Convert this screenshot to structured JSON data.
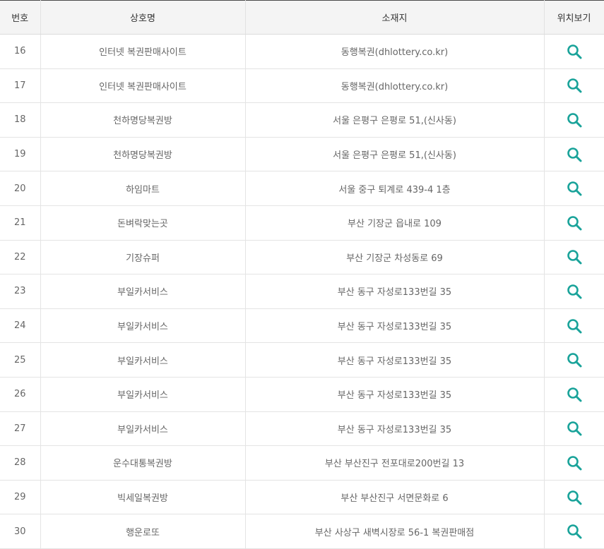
{
  "table": {
    "headers": {
      "no": "번호",
      "name": "상호명",
      "address": "소재지",
      "location": "위치보기"
    },
    "rows": [
      {
        "no": "16",
        "name": "인터넷 복권판매사이트",
        "address": "동행복권(dhlottery.co.kr)"
      },
      {
        "no": "17",
        "name": "인터넷 복권판매사이트",
        "address": "동행복권(dhlottery.co.kr)"
      },
      {
        "no": "18",
        "name": "천하명당복권방",
        "address": "서울 은평구 은평로 51,(신사동)"
      },
      {
        "no": "19",
        "name": "천하명당복권방",
        "address": "서울 은평구 은평로 51,(신사동)"
      },
      {
        "no": "20",
        "name": "하임마트",
        "address": "서울 중구 퇴계로 439-4 1층"
      },
      {
        "no": "21",
        "name": "돈벼락맞는곳",
        "address": "부산 기장군 읍내로 109"
      },
      {
        "no": "22",
        "name": "기장슈퍼",
        "address": "부산 기장군 차성동로 69"
      },
      {
        "no": "23",
        "name": "부일카서비스",
        "address": "부산 동구 자성로133번길 35"
      },
      {
        "no": "24",
        "name": "부일카서비스",
        "address": "부산 동구 자성로133번길 35"
      },
      {
        "no": "25",
        "name": "부일카서비스",
        "address": "부산 동구 자성로133번길 35"
      },
      {
        "no": "26",
        "name": "부일카서비스",
        "address": "부산 동구 자성로133번길 35"
      },
      {
        "no": "27",
        "name": "부일카서비스",
        "address": "부산 동구 자성로133번길 35"
      },
      {
        "no": "28",
        "name": "운수대통복권방",
        "address": "부산 부산진구 전포대로200번길 13"
      },
      {
        "no": "29",
        "name": "빅세일복권방",
        "address": "부산 부산진구 서면문화로 6"
      },
      {
        "no": "30",
        "name": "행운로또",
        "address": "부산 사상구 새벽시장로 56-1 복권판매점"
      }
    ]
  },
  "colors": {
    "accent": "#1aa39a",
    "header_bg": "#f4f4f4",
    "border": "#e4e4e4"
  },
  "icons": {
    "location": "search-icon"
  }
}
